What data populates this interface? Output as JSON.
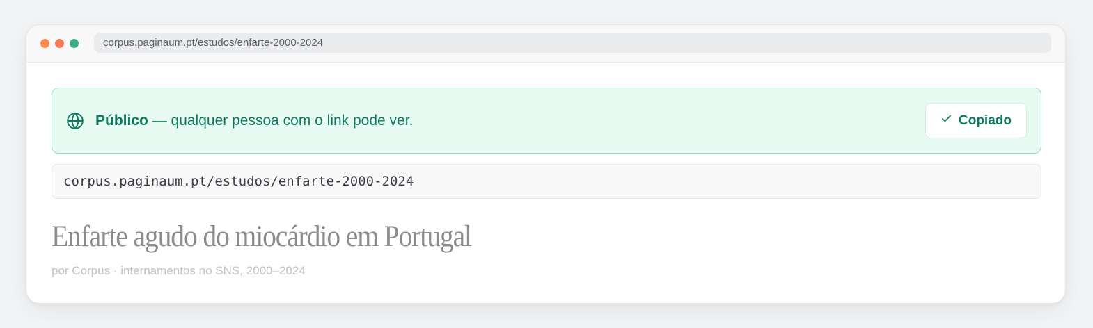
{
  "browser": {
    "url": "corpus.paginaum.pt/estudos/enfarte-2000-2024",
    "dots": {
      "red": "#fd8c4e",
      "yellow": "#f67c57",
      "green": "#3bae86"
    }
  },
  "share": {
    "status_label": "Público",
    "status_text": "— qualquer pessoa com o link pode ver.",
    "status_icon": "globe-icon",
    "copy_label": "Copiado",
    "copy_icon": "check-icon",
    "link": "corpus.paginaum.pt/estudos/enfarte-2000-2024",
    "accent": "#0d7a5f",
    "banner_bg": "#e8fbf3"
  },
  "document": {
    "title": "Enfarte agudo do miocárdio em Portugal",
    "subtitle": "por Corpus · internamentos no SNS, 2000–2024"
  }
}
